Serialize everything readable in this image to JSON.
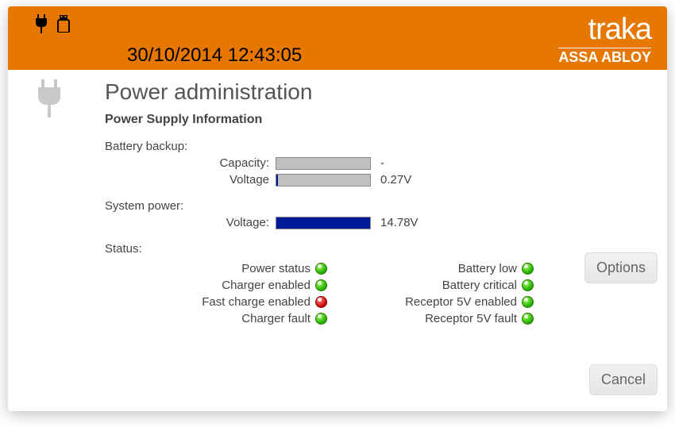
{
  "colors": {
    "header": "#e67700",
    "fill": "#001a9a"
  },
  "datetime": "30/10/2014 12:43:05",
  "brand": {
    "name": "traka",
    "sub": "ASSA ABLOY"
  },
  "page": {
    "title": "Power administration",
    "section": "Power Supply Information"
  },
  "battery": {
    "group": "Battery backup:",
    "capacity_label": "Capacity:",
    "capacity_value": "-",
    "capacity_fill_pct": 0,
    "voltage_label": "Voltage",
    "voltage_value": "0.27V",
    "voltage_fill_pct": 2
  },
  "system": {
    "group": "System power:",
    "voltage_label": "Voltage:",
    "voltage_value": "14.78V",
    "voltage_fill_pct": 100
  },
  "status": {
    "label": "Status:",
    "left": {
      "power_status": {
        "label": "Power status",
        "led": "green"
      },
      "charger_enabled": {
        "label": "Charger enabled",
        "led": "green"
      },
      "fast_charge_enabled": {
        "label": "Fast charge enabled",
        "led": "red"
      },
      "charger_fault": {
        "label": "Charger fault",
        "led": "green"
      }
    },
    "right": {
      "battery_low": {
        "label": "Battery low",
        "led": "green"
      },
      "battery_critical": {
        "label": "Battery critical",
        "led": "green"
      },
      "receptor5v_enabled": {
        "label": "Receptor 5V enabled",
        "led": "green"
      },
      "receptor5v_fault": {
        "label": "Receptor 5V fault",
        "led": "green"
      }
    }
  },
  "buttons": {
    "options": "Options",
    "cancel": "Cancel"
  }
}
